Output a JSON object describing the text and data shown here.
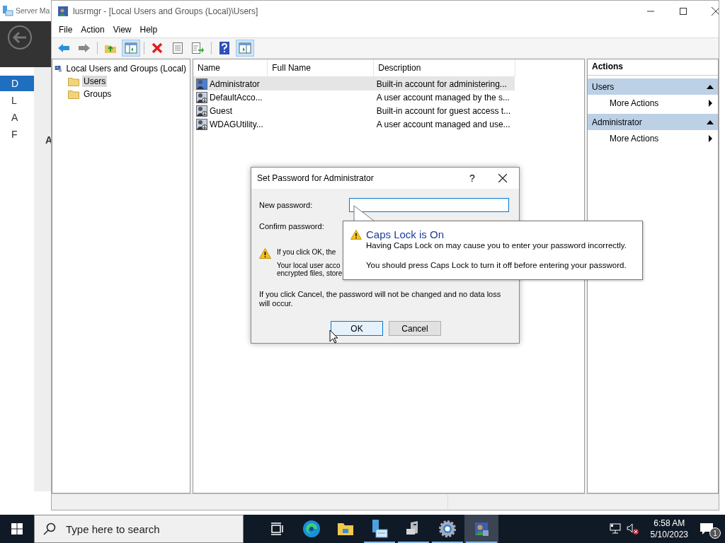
{
  "background_window": {
    "title": "Server Ma",
    "heading": "A",
    "nav": [
      {
        "label": "D",
        "selected": true
      },
      {
        "label": "L",
        "selected": false
      },
      {
        "label": "A",
        "selected": false
      },
      {
        "label": "F",
        "selected": false
      }
    ]
  },
  "window": {
    "title": "lusrmgr - [Local Users and Groups (Local)\\Users]",
    "menu": [
      "File",
      "Action",
      "View",
      "Help"
    ],
    "toolbar": [
      {
        "kind": "back",
        "pressed": false
      },
      {
        "kind": "forward",
        "pressed": false
      },
      {
        "kind": "sep"
      },
      {
        "kind": "up",
        "pressed": false
      },
      {
        "kind": "tree",
        "pressed": true
      },
      {
        "kind": "sep"
      },
      {
        "kind": "delete",
        "pressed": false
      },
      {
        "kind": "properties",
        "pressed": false
      },
      {
        "kind": "export",
        "pressed": false
      },
      {
        "kind": "sep"
      },
      {
        "kind": "help",
        "pressed": false
      },
      {
        "kind": "actionpane",
        "pressed": true
      }
    ],
    "tree": {
      "label": "Local Users and Groups (Local)",
      "children": [
        {
          "label": "Users",
          "selected": true
        },
        {
          "label": "Groups",
          "selected": false
        }
      ]
    },
    "table": {
      "columns": [
        "Name",
        "Full Name",
        "Description"
      ],
      "rows": [
        {
          "name": "Administrator",
          "description": "Built-in account for administering...",
          "selected": true,
          "disabled": false
        },
        {
          "name": "DefaultAcco...",
          "description": "A user account managed by the s...",
          "selected": false,
          "disabled": true
        },
        {
          "name": "Guest",
          "description": "Built-in account for guest access t...",
          "selected": false,
          "disabled": true
        },
        {
          "name": "WDAGUtility...",
          "description": "A user account managed and use...",
          "selected": false,
          "disabled": true
        }
      ]
    },
    "actions": {
      "title": "Actions",
      "groups": [
        {
          "title": "Users",
          "expanded": true,
          "items": [
            "More Actions"
          ]
        },
        {
          "title": "Administrator",
          "expanded": true,
          "items": [
            "More Actions"
          ]
        }
      ]
    }
  },
  "dialog": {
    "title": "Set Password for Administrator",
    "help": "?",
    "new_password_label": "New password:",
    "confirm_password_label": "Confirm password:",
    "warning_lines": [
      "If you click OK, the",
      "Your local user acco",
      "encrypted files, store"
    ],
    "cancel_note": "If you click Cancel, the password will not be changed and no data loss will occur.",
    "buttons": [
      {
        "label": "OK",
        "default": true
      },
      {
        "label": "Cancel",
        "default": false
      }
    ]
  },
  "balloon": {
    "title": "Caps Lock is On",
    "lines": [
      "Having Caps Lock on may cause you to enter your password incorrectly.",
      "You should press Caps Lock to turn it off before entering your password."
    ]
  },
  "taskbar": {
    "search_placeholder": "Type here to search",
    "apps": [
      {
        "kind": "taskview",
        "running": false,
        "active": false
      },
      {
        "kind": "browser",
        "running": false,
        "active": false
      },
      {
        "kind": "folder",
        "running": false,
        "active": false
      },
      {
        "kind": "servermanager",
        "running": true,
        "active": false
      },
      {
        "kind": "computer",
        "running": true,
        "active": false
      },
      {
        "kind": "gear",
        "running": true,
        "active": false
      },
      {
        "kind": "users",
        "running": true,
        "active": true
      }
    ],
    "time": "6:58 AM",
    "date": "5/10/2023",
    "notifications": "1"
  }
}
